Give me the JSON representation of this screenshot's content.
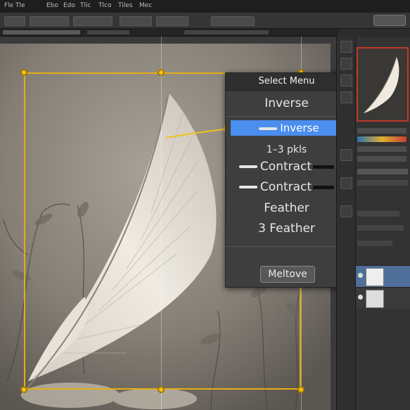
{
  "menubar": {
    "items": [
      "Fle",
      "Tle",
      "Ebo",
      "Edo",
      "Tlic",
      "Tlco",
      "Tiles",
      "Mec"
    ]
  },
  "context_menu": {
    "title": "Select Menu",
    "items": [
      {
        "label": "Inverse",
        "highlighted": false
      },
      {
        "label": "Inverse",
        "highlighted": true
      },
      {
        "label": "1–3 pkls",
        "highlighted": false
      },
      {
        "label": "Contract",
        "highlighted": false
      },
      {
        "label": "Contract",
        "highlighted": false
      },
      {
        "label": "Feather",
        "highlighted": false
      },
      {
        "label": "3 Feather",
        "highlighted": false
      }
    ],
    "button_label": "Meltove"
  },
  "colors": {
    "selection": "#e6ad12",
    "highlight": "#4a8ef0",
    "preview_border": "#c0392b"
  }
}
